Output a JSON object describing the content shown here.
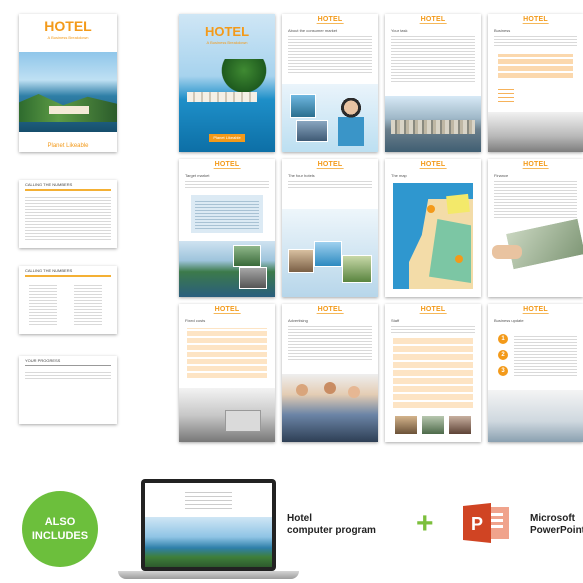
{
  "cover": {
    "title": "HOTEL",
    "subtitle": "A Business Breakdown",
    "footer": "Planet Likeable"
  },
  "pages": [
    {
      "header": "HOTEL",
      "title": "HOTEL",
      "subtitle": "A Business Breakdown",
      "button": "Planet Likeable"
    },
    {
      "header": "HOTEL",
      "title": "About the consumer market"
    },
    {
      "header": "HOTEL",
      "title": "Your task"
    },
    {
      "header": "HOTEL",
      "title": "Business"
    },
    {
      "header": "HOTEL",
      "title": "Target market"
    },
    {
      "header": "HOTEL",
      "title": "The four hotels"
    },
    {
      "header": "HOTEL",
      "title": "The map"
    },
    {
      "header": "HOTEL",
      "title": "Finance"
    },
    {
      "header": "HOTEL",
      "title": "Fixed costs"
    },
    {
      "header": "HOTEL",
      "title": "Advertising"
    },
    {
      "header": "HOTEL",
      "title": "Staff"
    },
    {
      "header": "HOTEL",
      "title": "Business update"
    }
  ],
  "side_pages": [
    {
      "title": "CALLING THE NUMBERS"
    },
    {
      "title": "CALLING THE NUMBERS"
    },
    {
      "title": "YOUR PROGRESS"
    }
  ],
  "badge": {
    "line1": "ALSO",
    "line2": "INCLUDES"
  },
  "program": {
    "line1": "Hotel",
    "line2": "computer program"
  },
  "plus": "+",
  "ppt": {
    "line1": "Microsoft",
    "line2": "PowerPoint",
    "letter": "P"
  },
  "colors": {
    "orange": "#f39a1a",
    "green": "#6cbf3c",
    "ppt_red": "#d04423"
  }
}
